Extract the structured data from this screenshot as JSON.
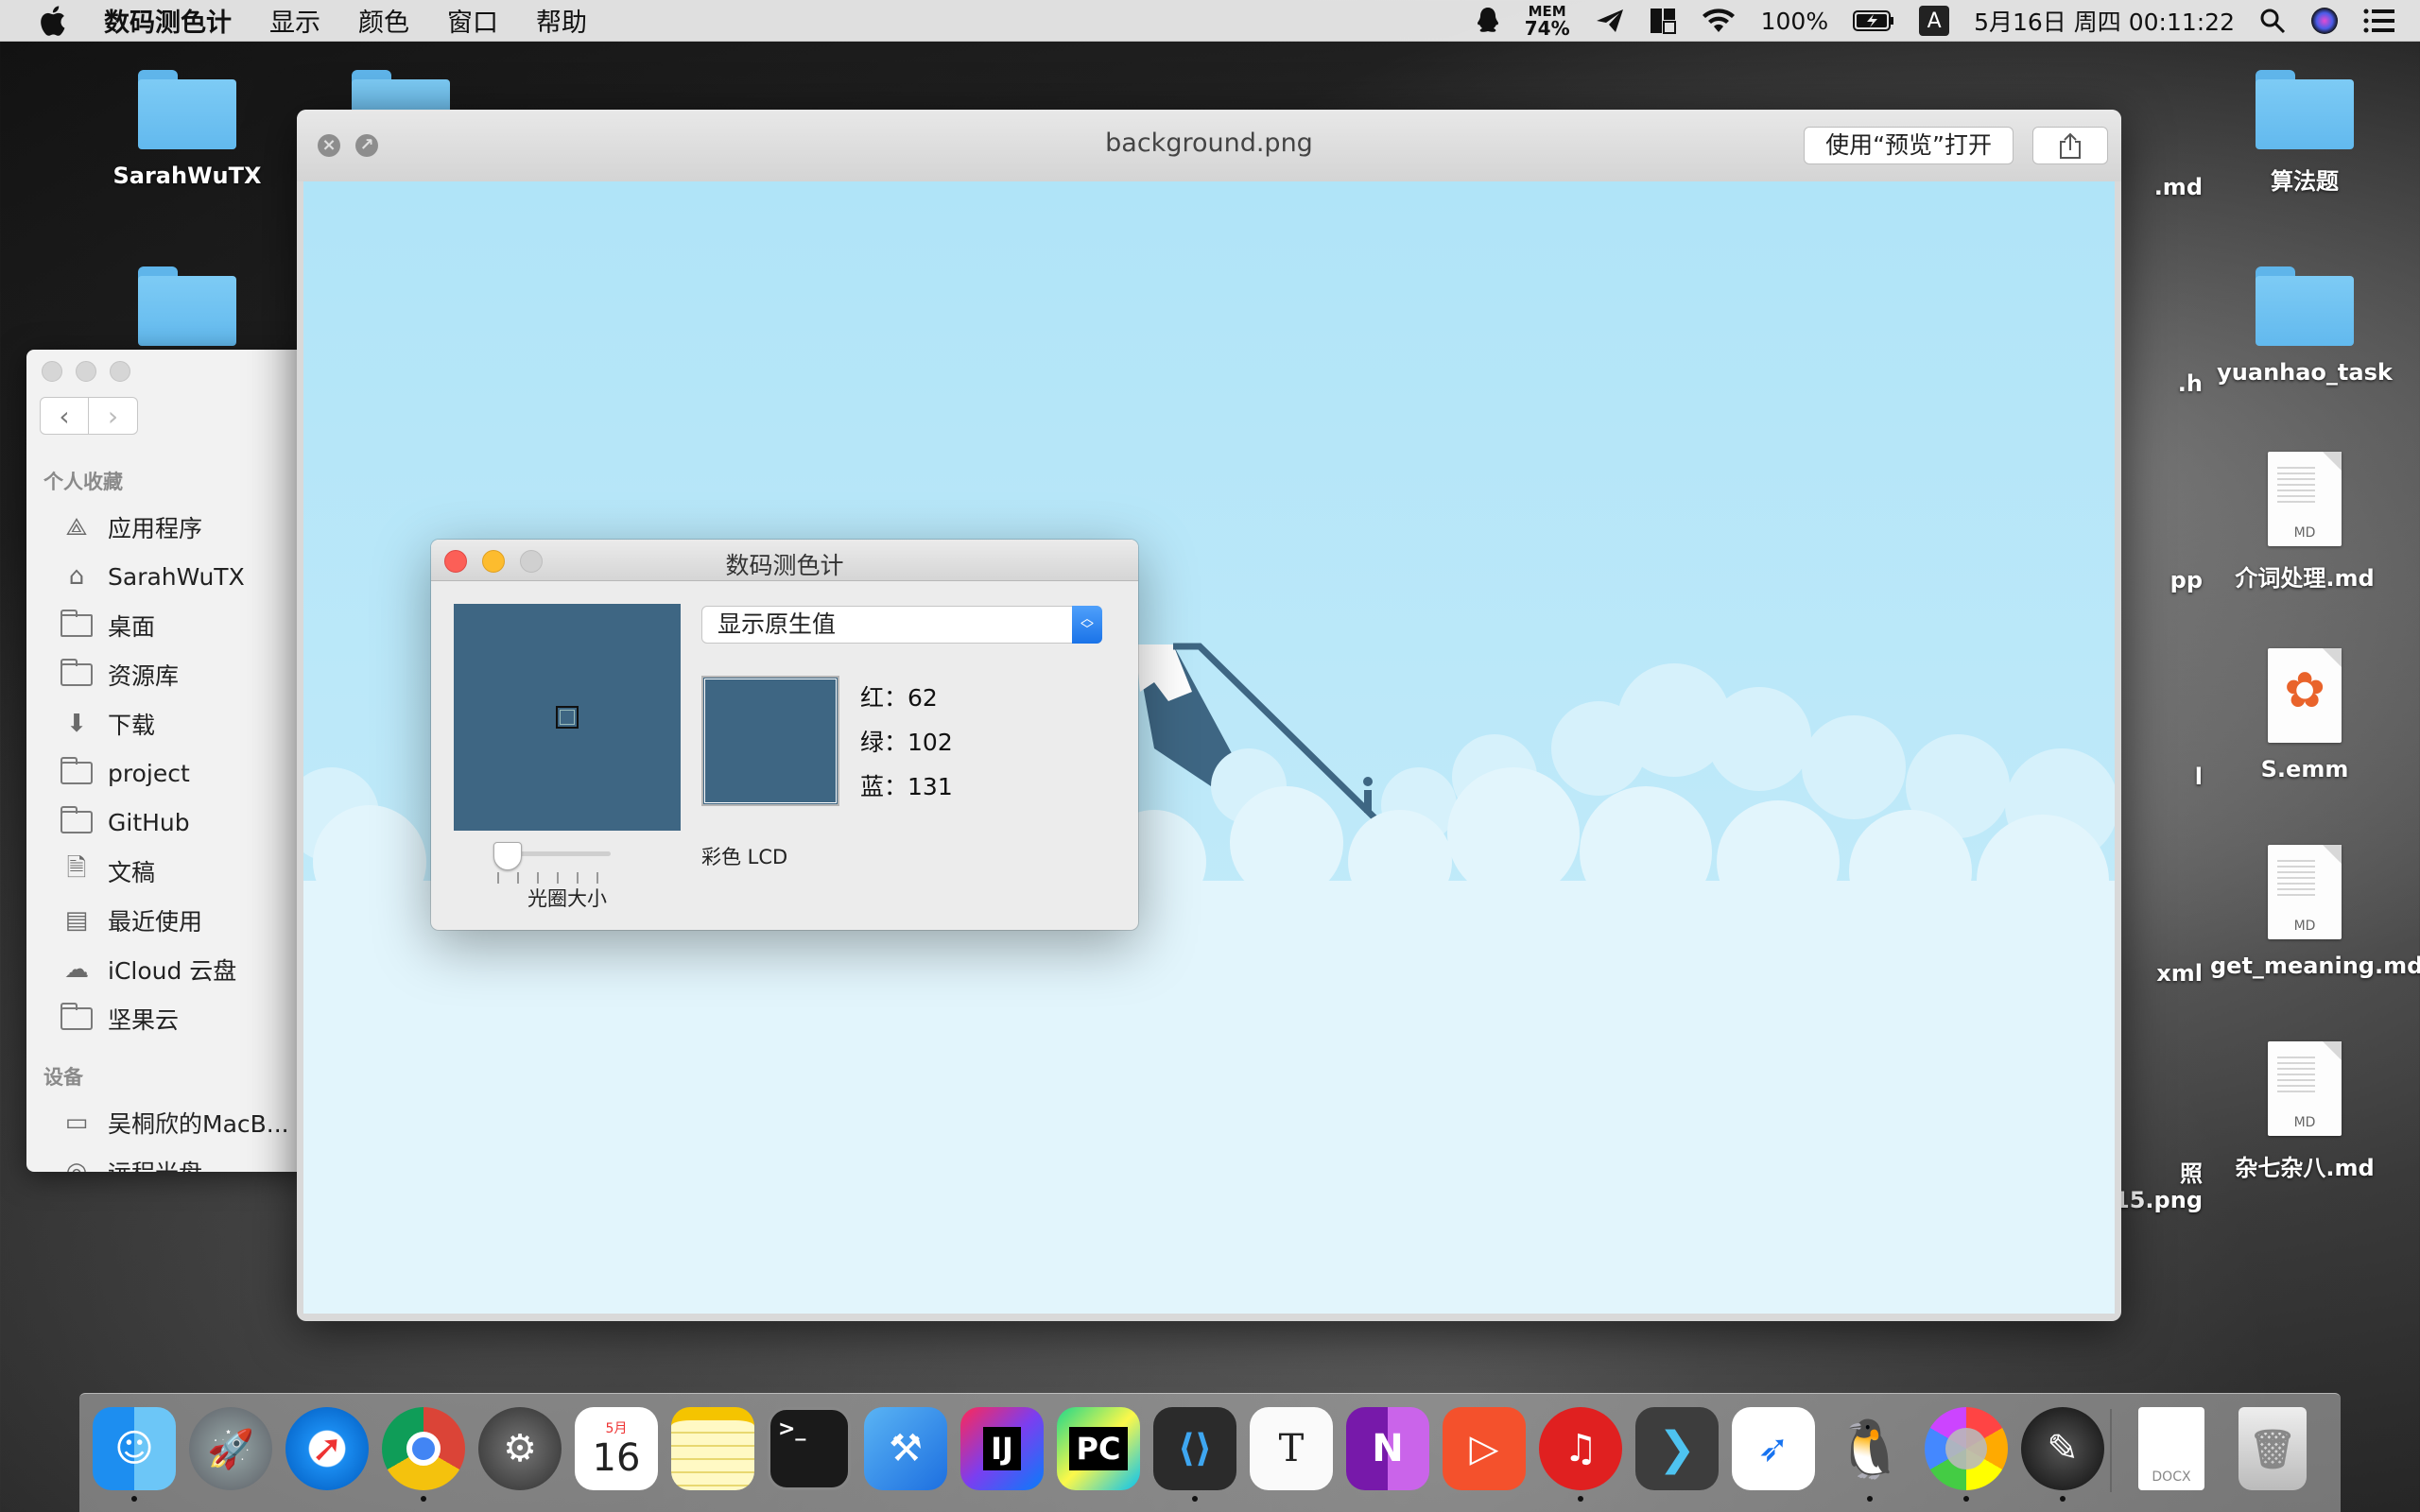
{
  "menubar": {
    "app_name": "数码测色计",
    "items": [
      "显示",
      "颜色",
      "窗口",
      "帮助"
    ],
    "mem_label": "MEM",
    "mem_value": "74%",
    "battery": "100%",
    "input_method": "A",
    "datetime": "5月16日 周四  00:11:22"
  },
  "desktop": {
    "left_icons": [
      {
        "label": "SarahWuTX",
        "type": "folder"
      }
    ],
    "right_icons": [
      {
        "label": "算法题",
        "type": "folder"
      },
      {
        "label": "yuanhao_task",
        "type": "folder"
      },
      {
        "label": "介词处理.md",
        "type": "md"
      },
      {
        "label": "S.emm",
        "type": "emm"
      },
      {
        "label": "get_meaning.md",
        "type": "md"
      },
      {
        "label": "杂七杂八.md",
        "type": "md"
      }
    ],
    "partial_labels": [
      ".md",
      ".h",
      "pp",
      "l",
      "xml",
      "照",
      "15.png"
    ]
  },
  "finder": {
    "favorites_header": "个人收藏",
    "favorites": [
      {
        "label": "应用程序",
        "icon": "apps-icon"
      },
      {
        "label": "SarahWuTX",
        "icon": "home-icon"
      },
      {
        "label": "桌面",
        "icon": "desktop-icon"
      },
      {
        "label": "资源库",
        "icon": "folder-icon"
      },
      {
        "label": "下载",
        "icon": "download-icon"
      },
      {
        "label": "project",
        "icon": "folder-icon"
      },
      {
        "label": "GitHub",
        "icon": "folder-icon"
      },
      {
        "label": "文稿",
        "icon": "documents-icon"
      },
      {
        "label": "最近使用",
        "icon": "recents-icon"
      },
      {
        "label": "iCloud 云盘",
        "icon": "cloud-icon"
      },
      {
        "label": "坚果云",
        "icon": "folder-icon"
      }
    ],
    "devices_header": "设备",
    "devices": [
      {
        "label": "吴桐欣的MacB...",
        "icon": "laptop-icon"
      },
      {
        "label": "远程光盘",
        "icon": "disc-icon"
      }
    ]
  },
  "quicklook": {
    "title": "background.png",
    "open_button": "使用“预览”打开",
    "share_icon": "share-icon"
  },
  "color_meter": {
    "title": "数码测色计",
    "display_mode": "显示原生值",
    "red_label": "红：",
    "red": "62",
    "green_label": "绿：",
    "green": "102",
    "blue_label": "蓝：",
    "blue": "131",
    "sample_color": "#3e6683",
    "profile": "彩色 LCD",
    "aperture_label": "光圈大小"
  },
  "dock": {
    "apps": [
      {
        "name": "finder-icon",
        "running": true
      },
      {
        "name": "launchpad-icon",
        "running": false
      },
      {
        "name": "safari-icon",
        "running": false
      },
      {
        "name": "chrome-icon",
        "running": true
      },
      {
        "name": "system-preferences-icon",
        "running": false
      },
      {
        "name": "calendar-icon",
        "running": false
      },
      {
        "name": "notes-icon",
        "running": false
      },
      {
        "name": "terminal-icon",
        "running": false
      },
      {
        "name": "xcode-icon",
        "running": false
      },
      {
        "name": "intellij-icon",
        "running": false
      },
      {
        "name": "pycharm-icon",
        "running": false
      },
      {
        "name": "vscode-icon",
        "running": true
      },
      {
        "name": "typora-icon",
        "running": false
      },
      {
        "name": "onenote-icon",
        "running": false
      },
      {
        "name": "video-player-icon",
        "running": false
      },
      {
        "name": "netease-music-icon",
        "running": true
      },
      {
        "name": "arrow-app-icon",
        "running": false
      },
      {
        "name": "feishu-icon",
        "running": false
      },
      {
        "name": "qq-icon",
        "running": true
      },
      {
        "name": "photos-ring-icon",
        "running": true
      },
      {
        "name": "digital-color-meter-icon",
        "running": true
      }
    ],
    "calendar_month": "5月",
    "calendar_day": "16",
    "terminal_text": ">_",
    "intellij_text": "IJ",
    "pycharm_text": "PC",
    "onenote_text": "N",
    "typora_text": "T"
  }
}
